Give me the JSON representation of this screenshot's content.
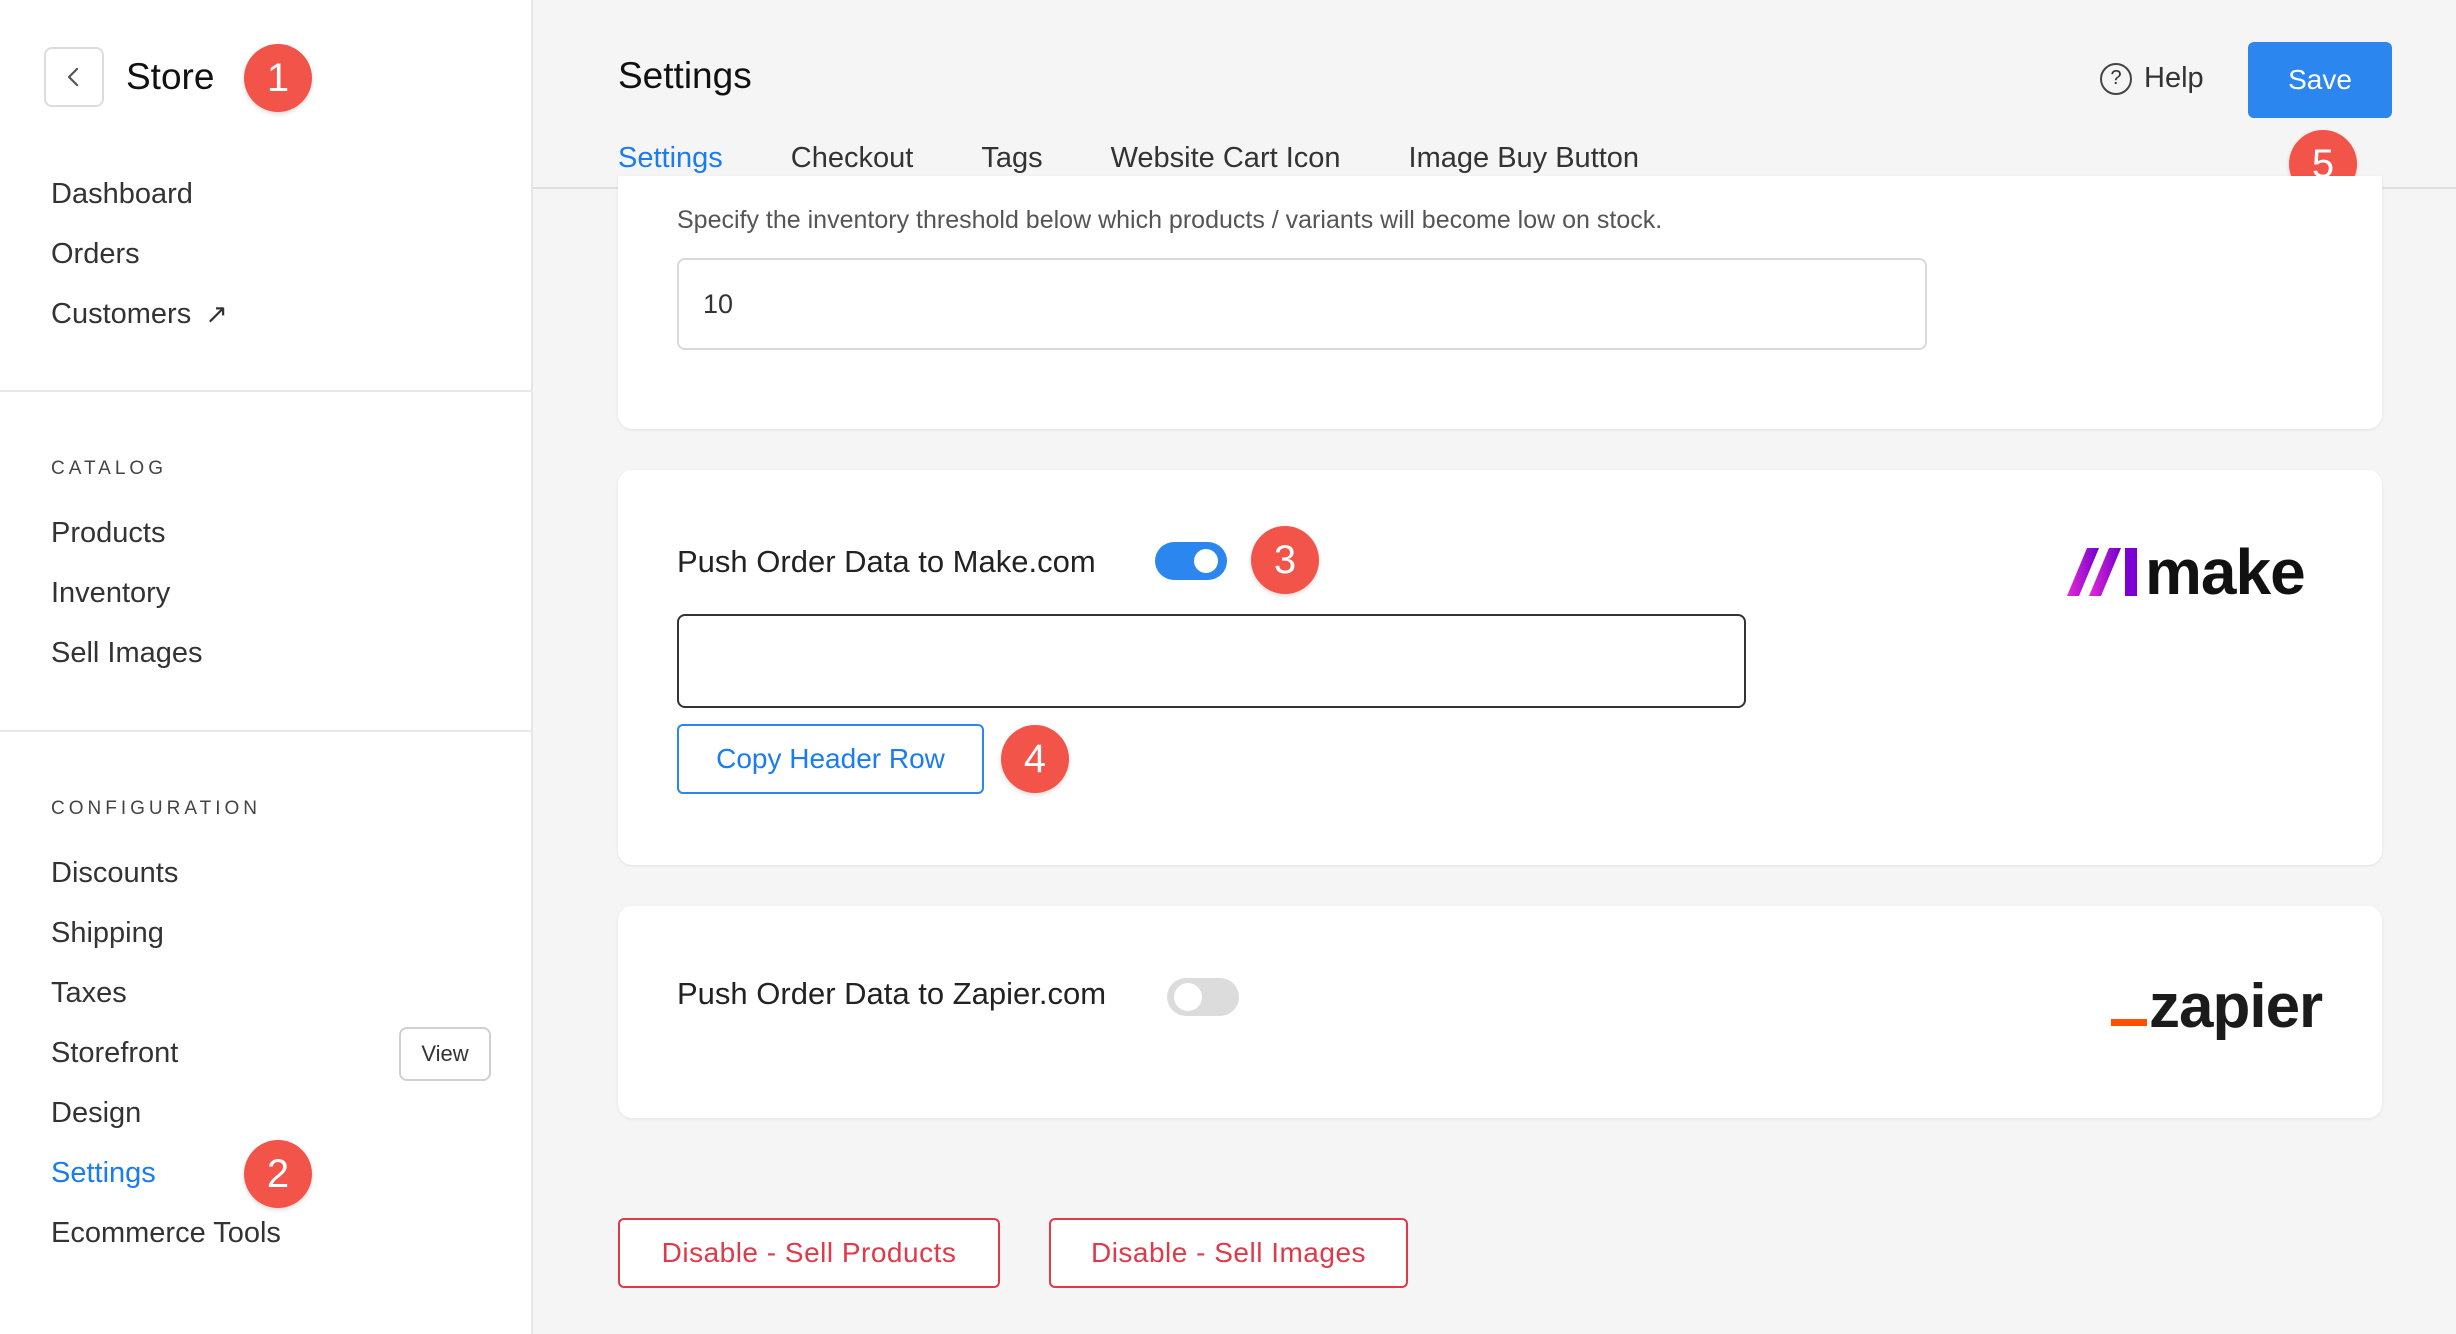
{
  "sidebar": {
    "title": "Store",
    "top_items": [
      {
        "label": "Dashboard"
      },
      {
        "label": "Orders"
      },
      {
        "label": "Customers",
        "external": "↗"
      }
    ],
    "catalog": {
      "label": "CATALOG",
      "items": [
        {
          "label": "Products"
        },
        {
          "label": "Inventory"
        },
        {
          "label": "Sell Images"
        }
      ]
    },
    "configuration": {
      "label": "CONFIGURATION",
      "items": [
        {
          "label": "Discounts"
        },
        {
          "label": "Shipping"
        },
        {
          "label": "Taxes"
        },
        {
          "label": "Storefront"
        },
        {
          "label": "Design"
        },
        {
          "label": "Settings",
          "active": true
        },
        {
          "label": "Ecommerce Tools"
        }
      ]
    },
    "view_label": "View"
  },
  "header": {
    "title": "Settings",
    "help_label": "Help",
    "save_label": "Save",
    "tabs": [
      {
        "label": "Settings",
        "active": true
      },
      {
        "label": "Checkout"
      },
      {
        "label": "Tags"
      },
      {
        "label": "Website Cart Icon"
      },
      {
        "label": "Image Buy Button"
      }
    ]
  },
  "inventory": {
    "hint": "Specify the inventory threshold below which products / variants will become low on stock.",
    "threshold_value": "10"
  },
  "make": {
    "label": "Push Order Data to Make.com",
    "enabled": true,
    "webhook_value": "",
    "copy_label": "Copy Header Row",
    "logo_text": "make"
  },
  "zapier": {
    "label": "Push Order Data to Zapier.com",
    "enabled": false,
    "logo_text": "zapier"
  },
  "footer": {
    "disable_products_label": "Disable - Sell Products",
    "disable_images_label": "Disable - Sell Images"
  },
  "annotations": [
    "1",
    "2",
    "3",
    "4",
    "5"
  ],
  "colors": {
    "accent": "#2b86f0",
    "danger": "#e0394a",
    "badge": "#f2544a",
    "zapier_orange": "#ff4f00"
  }
}
